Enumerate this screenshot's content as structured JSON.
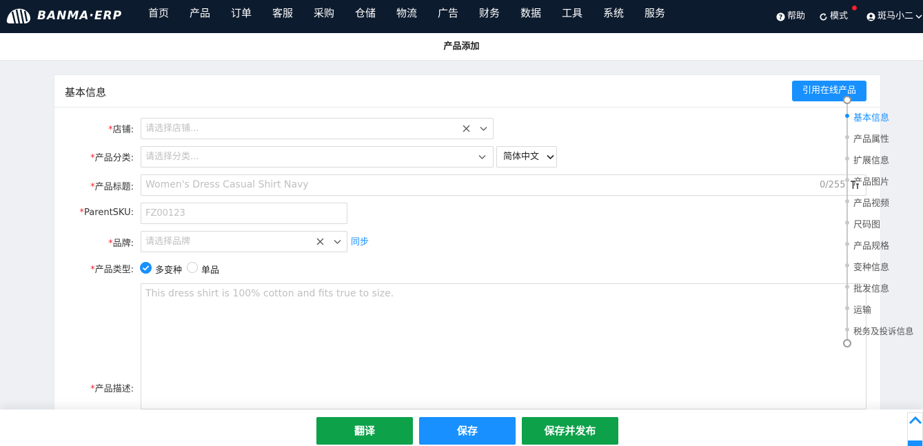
{
  "nav": {
    "logo_text": "BANMA·ERP",
    "menu": [
      "首页",
      "产品",
      "订单",
      "客服",
      "采购",
      "仓储",
      "物流",
      "广告",
      "财务",
      "数据",
      "工具",
      "系统",
      "服务"
    ],
    "help": "帮助",
    "mode": "模式",
    "user": "斑马小二"
  },
  "page": {
    "title": "产品添加"
  },
  "section": {
    "title": "基本信息",
    "ref_button": "引用在线产品"
  },
  "form": {
    "store": {
      "label": "店铺:",
      "placeholder": "请选择店铺..."
    },
    "category": {
      "label": "产品分类:",
      "placeholder": "请选择分类...",
      "language": "简体中文"
    },
    "title": {
      "label": "产品标题:",
      "placeholder": "Women's Dress Casual Shirt Navy",
      "counter": "0/255"
    },
    "parent_sku": {
      "label": "ParentSKU:",
      "placeholder": "FZ00123"
    },
    "brand": {
      "label": "品牌:",
      "placeholder": "请选择品牌",
      "sync": "同步"
    },
    "type": {
      "label": "产品类型:",
      "options": [
        "多变种",
        "单品"
      ],
      "selected": "多变种"
    },
    "description": {
      "label": "产品描述:",
      "placeholder": "This dress shirt is 100% cotton and fits true to size."
    },
    "required_mark": "*"
  },
  "anchors": [
    "基本信息",
    "产品属性",
    "扩展信息",
    "产品图片",
    "产品视频",
    "尺码图",
    "产品规格",
    "变种信息",
    "批发信息",
    "运输",
    "税务及投诉信息"
  ],
  "anchor_active": "基本信息",
  "actions": {
    "translate": "翻译",
    "save": "保存",
    "save_publish": "保存并发布"
  },
  "colors": {
    "nav_bg": "#0d1b2e",
    "primary": "#1890ff",
    "green": "#0da14a",
    "required": "#f5222d"
  }
}
